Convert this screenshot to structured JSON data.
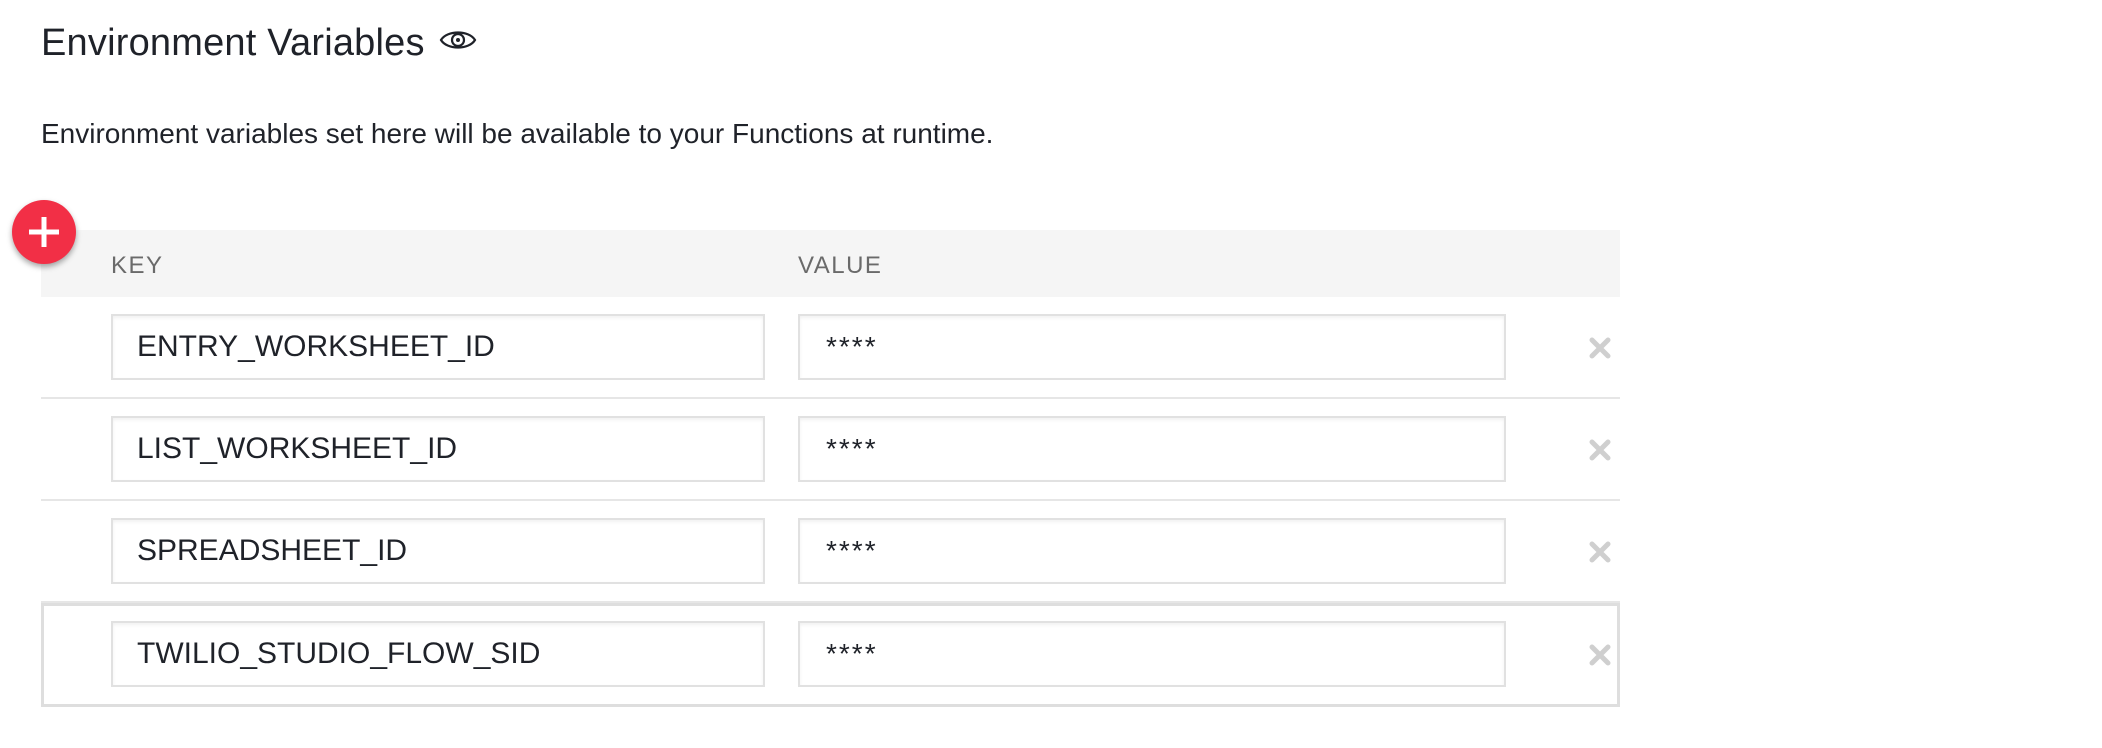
{
  "header": {
    "title": "Environment Variables",
    "visibility_icon": "eye-icon"
  },
  "description": "Environment variables set here will be available to your Functions at runtime.",
  "add_button": {
    "icon": "plus-icon",
    "color": "#f22f46"
  },
  "table": {
    "columns": {
      "key": "KEY",
      "value": "VALUE"
    },
    "rows": [
      {
        "key": "ENTRY_WORKSHEET_ID",
        "value": "****",
        "remove_icon": "close-icon"
      },
      {
        "key": "LIST_WORKSHEET_ID",
        "value": "****",
        "remove_icon": "close-icon"
      },
      {
        "key": "SPREADSHEET_ID",
        "value": "****",
        "remove_icon": "close-icon"
      },
      {
        "key": "TWILIO_STUDIO_FLOW_SID",
        "value": "****",
        "remove_icon": "close-icon",
        "selected": true
      }
    ]
  }
}
